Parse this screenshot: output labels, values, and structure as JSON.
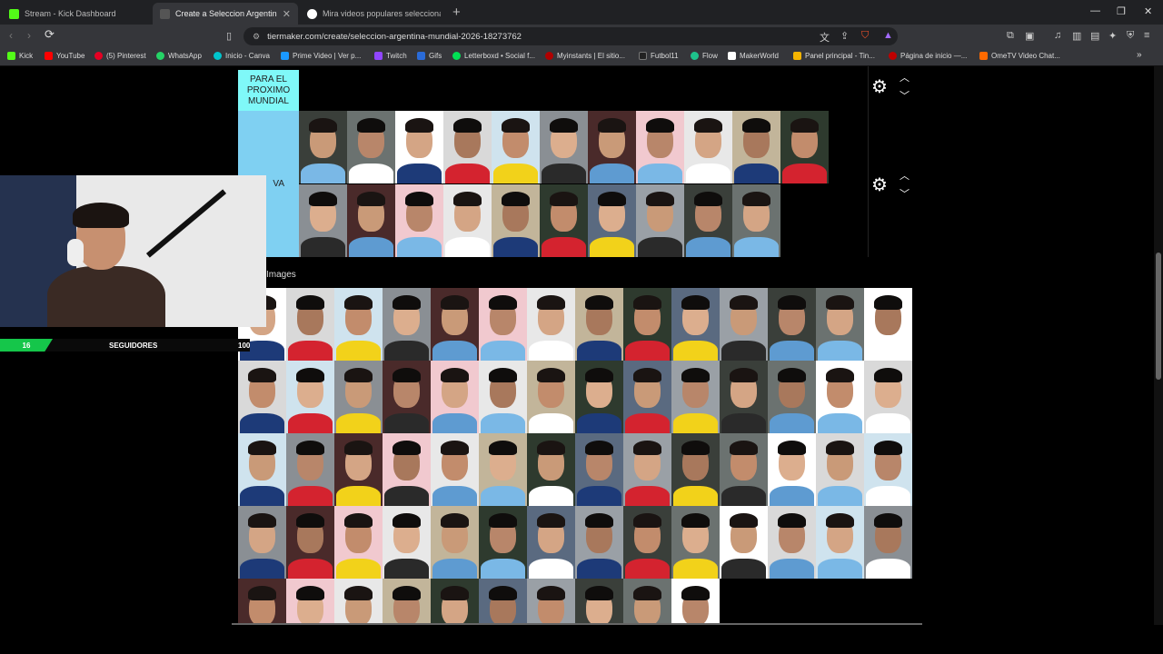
{
  "tabs": [
    {
      "title": "Stream - Kick Dashboard",
      "color": "#53fc18"
    },
    {
      "title": "Create a Seleccion Argentina Mu",
      "color": "#555555"
    },
    {
      "title": "Mira videos populares seleccionados",
      "color": "#ffffff"
    }
  ],
  "address": {
    "url": "tiermaker.com/create/seleccion-argentina-mundial-2026-18273762"
  },
  "bookmarks": [
    {
      "label": "Kick",
      "color": "#53fc18"
    },
    {
      "label": "YouTube",
      "color": "#ff0000"
    },
    {
      "label": "(5) Pinterest",
      "color": "#e60023"
    },
    {
      "label": "WhatsApp",
      "color": "#25d366"
    },
    {
      "label": "Inicio - Canva",
      "color": "#00c4cc"
    },
    {
      "label": "Prime Video | Ver p...",
      "color": "#1a98ff"
    },
    {
      "label": "Twitch",
      "color": "#9146ff"
    },
    {
      "label": "Gifs",
      "color": "#2a6bd8"
    },
    {
      "label": "Letterboxd • Social f...",
      "color": "#00e054"
    },
    {
      "label": "Myinstants | El sitio...",
      "color": "#b00000"
    },
    {
      "label": "Futbol11",
      "color": "#222222"
    },
    {
      "label": "Flow",
      "color": "#1ec28b"
    },
    {
      "label": "MakerWorld",
      "color": "#ffffff"
    },
    {
      "label": "Panel principal - Tin...",
      "color": "#f5b400"
    },
    {
      "label": "Página de inicio —...",
      "color": "#c00000"
    },
    {
      "label": "OmeTV Video Chat...",
      "color": "#ff6a00"
    }
  ],
  "tiers": [
    {
      "label": "PARA EL PROXIMO MUNDIAL"
    },
    {
      "label": "VA"
    }
  ],
  "pool": {
    "title": "Images"
  },
  "stream_overlay": {
    "count": "16",
    "label": "SEGUIDORES",
    "tail": "100"
  }
}
